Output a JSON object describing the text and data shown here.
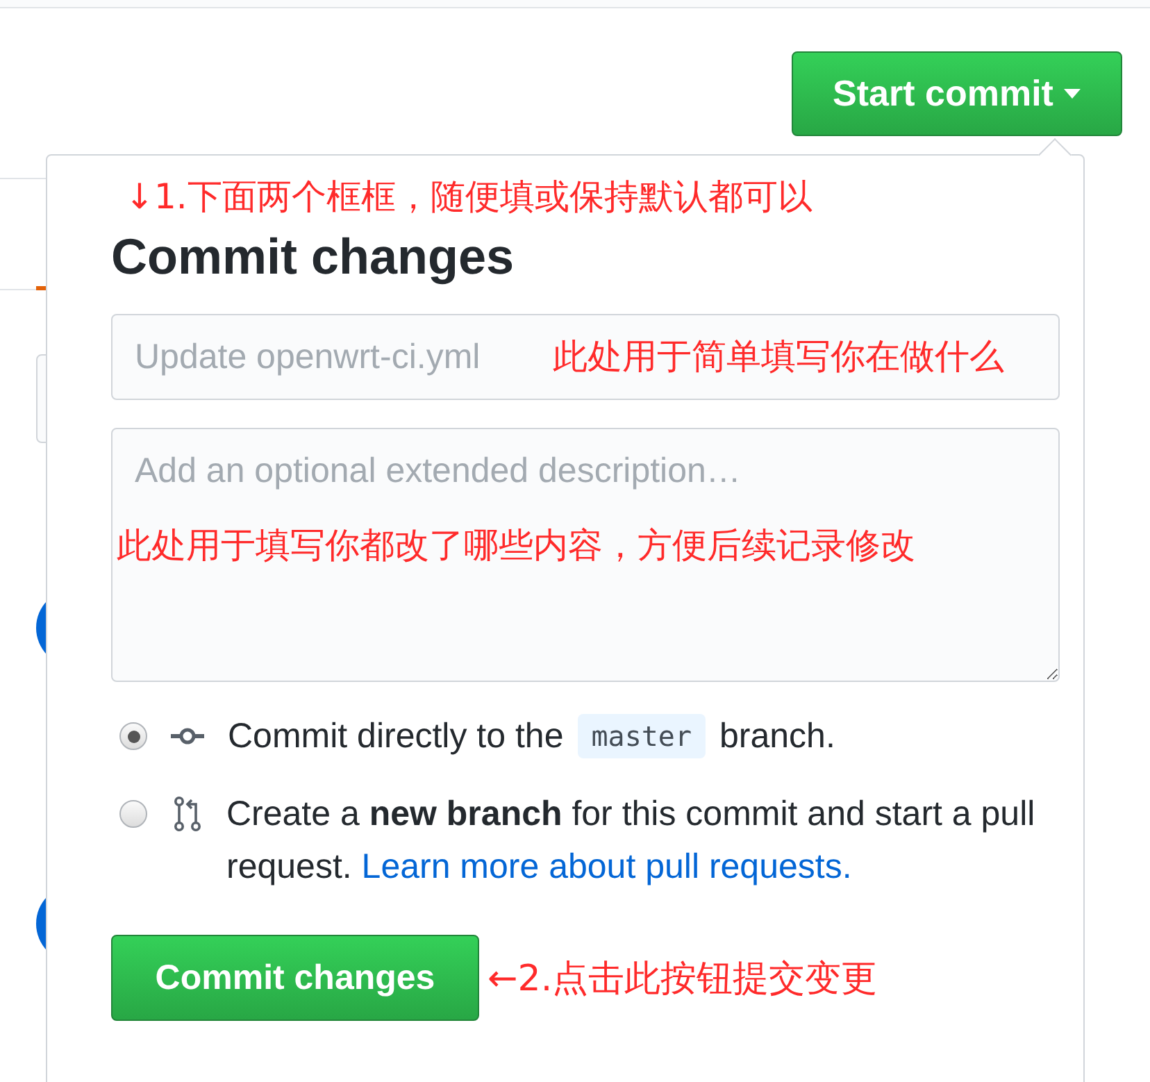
{
  "header": {
    "start_commit_button": "Start commit"
  },
  "commit_dialog": {
    "title": "Commit changes",
    "summary_field": {
      "placeholder": "Update openwrt-ci.yml"
    },
    "description_field": {
      "placeholder": "Add an optional extended description…"
    },
    "options": [
      {
        "selected": true,
        "kind": "direct",
        "text": "Commit directly to the",
        "branch": "master",
        "after": "branch."
      },
      {
        "selected": false,
        "kind": "new_branch",
        "text": "Create a **new branch** for this commit and start a pull request.",
        "link": "Learn more about pull requests."
      }
    ],
    "commit_button": "Commit changes"
  },
  "annotations": [
    "↓1.下面两个框框，随便填或保持默认都可以",
    "此处用于简单填写你在做什么",
    "此处用于填写你都改了哪些内容，方便后续记录修改",
    "←2.点击此按钮提交变更"
  ]
}
